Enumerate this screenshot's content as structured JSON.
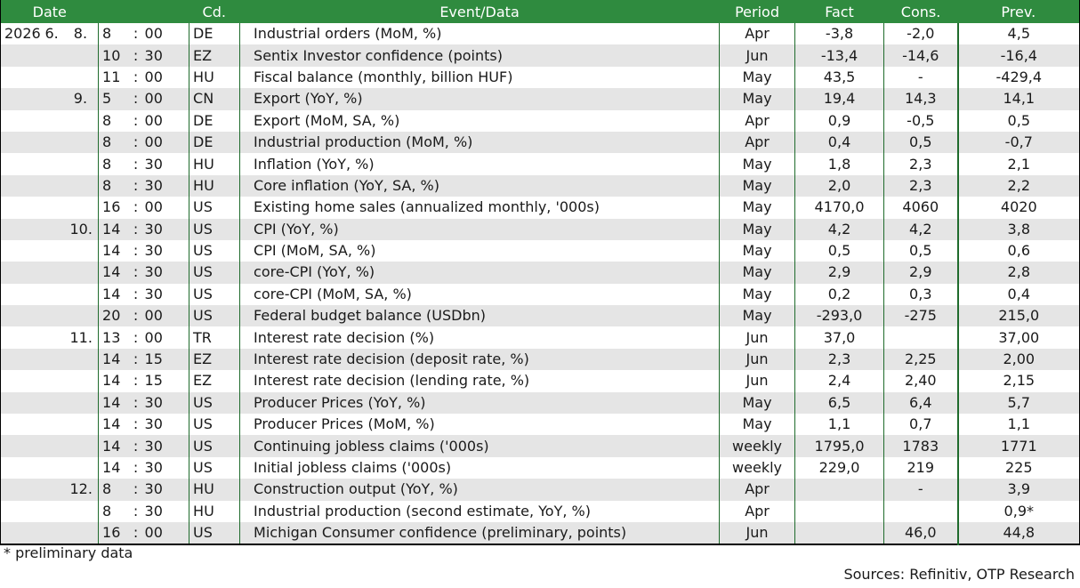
{
  "header": {
    "date": "Date",
    "cd": "Cd.",
    "event": "Event/Data",
    "period": "Period",
    "fact": "Fact",
    "cons": "Cons.",
    "prev": "Prev."
  },
  "rows": [
    {
      "year": "2026",
      "month": "6.",
      "day": "8.",
      "hh": "8",
      "mm": "00",
      "cd": "DE",
      "event": "Industrial orders (MoM, %)",
      "period": "Apr",
      "fact": "-3,8",
      "cons": "-2,0",
      "prev": "4,5"
    },
    {
      "year": "",
      "month": "",
      "day": "",
      "hh": "10",
      "mm": "30",
      "cd": "EZ",
      "event": "Sentix Investor confidence (points)",
      "period": "Jun",
      "fact": "-13,4",
      "cons": "-14,6",
      "prev": "-16,4"
    },
    {
      "year": "",
      "month": "",
      "day": "",
      "hh": "11",
      "mm": "00",
      "cd": "HU",
      "event": "Fiscal balance (monthly, billion HUF)",
      "period": "May",
      "fact": "43,5",
      "cons": "-",
      "prev": "-429,4"
    },
    {
      "year": "",
      "month": "",
      "day": "9.",
      "hh": "5",
      "mm": "00",
      "cd": "CN",
      "event": "Export (YoY, %)",
      "period": "May",
      "fact": "19,4",
      "cons": "14,3",
      "prev": "14,1"
    },
    {
      "year": "",
      "month": "",
      "day": "",
      "hh": "8",
      "mm": "00",
      "cd": "DE",
      "event": "Export (MoM, SA, %)",
      "period": "Apr",
      "fact": "0,9",
      "cons": "-0,5",
      "prev": "0,5"
    },
    {
      "year": "",
      "month": "",
      "day": "",
      "hh": "8",
      "mm": "00",
      "cd": "DE",
      "event": "Industrial production (MoM, %)",
      "period": "Apr",
      "fact": "0,4",
      "cons": "0,5",
      "prev": "-0,7"
    },
    {
      "year": "",
      "month": "",
      "day": "",
      "hh": "8",
      "mm": "30",
      "cd": "HU",
      "event": "Inflation (YoY, %)",
      "period": "May",
      "fact": "1,8",
      "cons": "2,3",
      "prev": "2,1"
    },
    {
      "year": "",
      "month": "",
      "day": "",
      "hh": "8",
      "mm": "30",
      "cd": "HU",
      "event": "Core inflation (YoY, SA, %)",
      "period": "May",
      "fact": "2,0",
      "cons": "2,3",
      "prev": "2,2"
    },
    {
      "year": "",
      "month": "",
      "day": "",
      "hh": "16",
      "mm": "00",
      "cd": "US",
      "event": "Existing home sales (annualized monthly, '000s)",
      "period": "May",
      "fact": "4170,0",
      "cons": "4060",
      "prev": "4020"
    },
    {
      "year": "",
      "month": "",
      "day": "10.",
      "hh": "14",
      "mm": "30",
      "cd": "US",
      "event": "CPI (YoY, %)",
      "period": "May",
      "fact": "4,2",
      "cons": "4,2",
      "prev": "3,8"
    },
    {
      "year": "",
      "month": "",
      "day": "",
      "hh": "14",
      "mm": "30",
      "cd": "US",
      "event": "CPI (MoM, SA, %)",
      "period": "May",
      "fact": "0,5",
      "cons": "0,5",
      "prev": "0,6"
    },
    {
      "year": "",
      "month": "",
      "day": "",
      "hh": "14",
      "mm": "30",
      "cd": "US",
      "event": "core-CPI (YoY, %)",
      "period": "May",
      "fact": "2,9",
      "cons": "2,9",
      "prev": "2,8"
    },
    {
      "year": "",
      "month": "",
      "day": "",
      "hh": "14",
      "mm": "30",
      "cd": "US",
      "event": "core-CPI (MoM, SA, %)",
      "period": "May",
      "fact": "0,2",
      "cons": "0,3",
      "prev": "0,4"
    },
    {
      "year": "",
      "month": "",
      "day": "",
      "hh": "20",
      "mm": "00",
      "cd": "US",
      "event": "Federal budget balance (USDbn)",
      "period": "May",
      "fact": "-293,0",
      "cons": "-275",
      "prev": "215,0"
    },
    {
      "year": "",
      "month": "",
      "day": "11.",
      "hh": "13",
      "mm": "00",
      "cd": "TR",
      "event": "Interest rate decision (%)",
      "period": "Jun",
      "fact": "37,0",
      "cons": "",
      "prev": "37,00"
    },
    {
      "year": "",
      "month": "",
      "day": "",
      "hh": "14",
      "mm": "15",
      "cd": "EZ",
      "event": "Interest rate decision (deposit rate, %)",
      "period": "Jun",
      "fact": "2,3",
      "cons": "2,25",
      "prev": "2,00"
    },
    {
      "year": "",
      "month": "",
      "day": "",
      "hh": "14",
      "mm": "15",
      "cd": "EZ",
      "event": "Interest rate decision (lending rate, %)",
      "period": "Jun",
      "fact": "2,4",
      "cons": "2,40",
      "prev": "2,15"
    },
    {
      "year": "",
      "month": "",
      "day": "",
      "hh": "14",
      "mm": "30",
      "cd": "US",
      "event": "Producer Prices (YoY, %)",
      "period": "May",
      "fact": "6,5",
      "cons": "6,4",
      "prev": "5,7"
    },
    {
      "year": "",
      "month": "",
      "day": "",
      "hh": "14",
      "mm": "30",
      "cd": "US",
      "event": "Producer Prices (MoM, %)",
      "period": "May",
      "fact": "1,1",
      "cons": "0,7",
      "prev": "1,1"
    },
    {
      "year": "",
      "month": "",
      "day": "",
      "hh": "14",
      "mm": "30",
      "cd": "US",
      "event": "Continuing jobless claims ('000s)",
      "period": "weekly",
      "fact": "1795,0",
      "cons": "1783",
      "prev": "1771"
    },
    {
      "year": "",
      "month": "",
      "day": "",
      "hh": "14",
      "mm": "30",
      "cd": "US",
      "event": "Initial jobless claims ('000s)",
      "period": "weekly",
      "fact": "229,0",
      "cons": "219",
      "prev": "225"
    },
    {
      "year": "",
      "month": "",
      "day": "12.",
      "hh": "8",
      "mm": "30",
      "cd": "HU",
      "event": "Construction output (YoY, %)",
      "period": "Apr",
      "fact": "",
      "cons": "-",
      "prev": "3,9"
    },
    {
      "year": "",
      "month": "",
      "day": "",
      "hh": "8",
      "mm": "30",
      "cd": "HU",
      "event": "Industrial production (second estimate, YoY, %)",
      "period": "Apr",
      "fact": "",
      "cons": "",
      "prev": "0,9*"
    },
    {
      "year": "",
      "month": "",
      "day": "",
      "hh": "16",
      "mm": "00",
      "cd": "US",
      "event": "Michigan Consumer confidence (preliminary, points)",
      "period": "Jun",
      "fact": "",
      "cons": "46,0",
      "prev": "44,8"
    }
  ],
  "time_separator": ":",
  "footnote": "* preliminary data",
  "sources": "Sources: Refinitiv, OTP Research"
}
